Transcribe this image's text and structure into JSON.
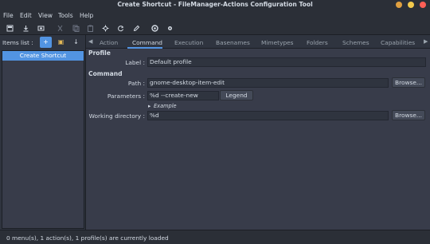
{
  "window": {
    "title": "Create Shortcut - FileManager-Actions Configuration Tool"
  },
  "menubar": {
    "items": [
      "File",
      "Edit",
      "View",
      "Tools",
      "Help"
    ]
  },
  "toolbar": {
    "icons": [
      "new-menu-icon",
      "new-action-icon",
      "new-profile-icon",
      "cut-icon",
      "copy-icon",
      "paste-icon",
      "preferences-icon",
      "reload-icon",
      "edit-icon",
      "help-icon",
      "about-icon"
    ]
  },
  "left_pane": {
    "label": "Items list :",
    "add_symbol": "+",
    "paste_symbol": "▣",
    "down_symbol": "↓",
    "items": [
      "Create Shortcut"
    ]
  },
  "tabs": {
    "left_arrow": "◀",
    "right_arrow": "▶",
    "items": [
      "Action",
      "Command",
      "Execution",
      "Basenames",
      "Mimetypes",
      "Folders",
      "Schemes",
      "Capabilities"
    ],
    "active": "Command"
  },
  "profile": {
    "heading": "Profile",
    "label_caption": "Label :",
    "label_value": "Default profile"
  },
  "command": {
    "heading": "Command",
    "path_caption": "Path :",
    "path_value": "gnome-desktop-item-edit",
    "parameters_caption": "Parameters :",
    "parameters_value": "%d --create-new",
    "legend_button": "Legend",
    "example_label": "Example",
    "workdir_caption": "Working directory :",
    "workdir_value": "%d",
    "browse_label": "Browse..."
  },
  "status": {
    "text": "0 menu(s), 1 action(s), 1 profile(s) are currently loaded"
  }
}
